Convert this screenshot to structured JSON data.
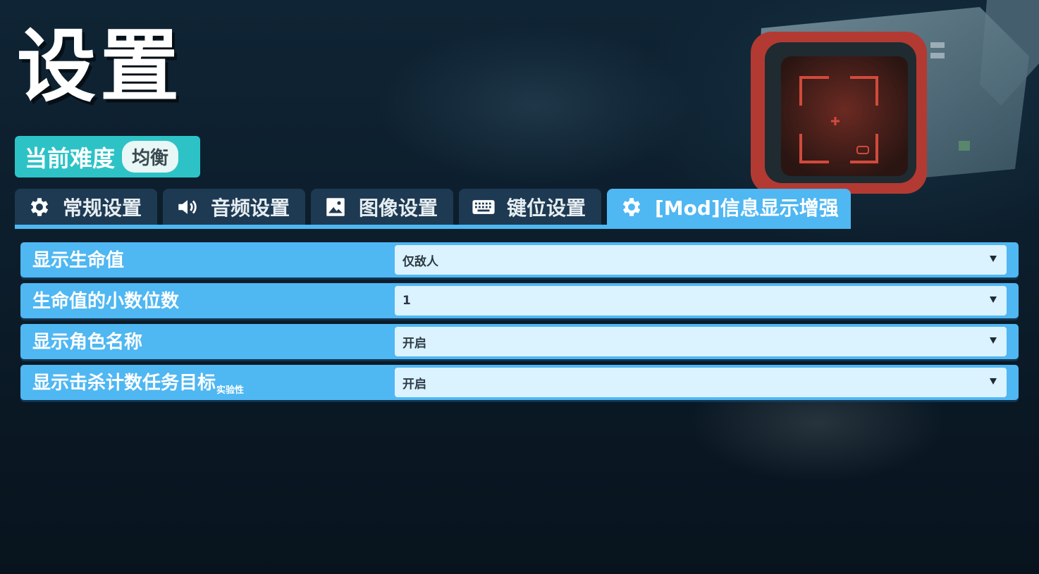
{
  "page": {
    "title": "设置"
  },
  "difficulty": {
    "label": "当前难度",
    "value": "均衡"
  },
  "tabs": [
    {
      "label": "常规设置",
      "icon": "gear-icon",
      "active": false
    },
    {
      "label": "音频设置",
      "icon": "speaker-icon",
      "active": false
    },
    {
      "label": "图像设置",
      "icon": "image-icon",
      "active": false
    },
    {
      "label": "键位设置",
      "icon": "keyboard-icon",
      "active": false
    },
    {
      "label": "[Mod]信息显示增强",
      "icon": "gear-icon",
      "active": true
    }
  ],
  "settings": [
    {
      "label": "显示生命值",
      "note": "",
      "value": "仅敌人"
    },
    {
      "label": "生命值的小数位数",
      "note": "",
      "value": "1"
    },
    {
      "label": "显示角色名称",
      "note": "",
      "value": "开启"
    },
    {
      "label": "显示击杀计数任务目标",
      "note": "实验性",
      "value": "开启"
    }
  ],
  "colors": {
    "accent": "#4fb7f2",
    "tab_inactive": "#1e3a52",
    "difficulty_bg": "#2dc3c6",
    "select_bg": "#dbf2ff",
    "background": "#0f2434"
  }
}
